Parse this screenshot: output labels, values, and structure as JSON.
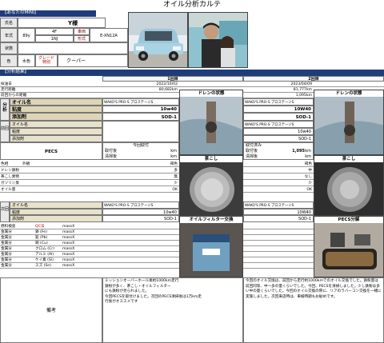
{
  "title": "オイル分析カルテ",
  "your_mini": {
    "section": "【あなたのMINI】",
    "name_label": "氏名",
    "name_value": "Y様",
    "model_year_label": "年式",
    "model_year_value": "89y",
    "spec1_top": "4F",
    "spec1_bottom": "1NJ",
    "spec2_top": "車両",
    "spec2_bottom": "形式",
    "engine_value": "E-XN12A",
    "condition_label": "状態",
    "color_label": "色",
    "color_value": "水色",
    "grade_label": "グレード",
    "grade_sub": "特別",
    "grade_value": "クーパー"
  },
  "results": {
    "section": "【分析結果】",
    "round1_header": "1回目",
    "round2_header": "2回目",
    "rows": [
      {
        "label": "採油日",
        "v1": "2022/10/02",
        "v2": "2023/04/09"
      },
      {
        "label": "走行距離",
        "v1": "80,682km",
        "v2": "81,777km"
      },
      {
        "label": "前回からの距離",
        "v1": "",
        "v2": "1,095km"
      }
    ],
    "analysis_group": "分析",
    "oil_name_label": "オイル名",
    "viscosity_label": "粘度",
    "additive_label": "添加剤",
    "r1_oil_name": "WAKO'S PRO-S プロステージS",
    "r1_viscosity": "10w40",
    "r1_additive": "SOD-1",
    "r2_oil_name": "WAKO'S PRO-S プロステージS",
    "r2_viscosity": "10W40",
    "r2_additive": "SOD-1",
    "prev_group": "前回",
    "r2_prev_oil_name": "WAKO'S PRO-S プロステージS",
    "r2_prev_viscosity": "10w40",
    "r2_prev_additive": "SOD-1",
    "pecs_label": "PECS",
    "r1_pecs_top": "今回取付",
    "r1_pecs_mid": "取付後",
    "r1_pecs_bot": "清掃後",
    "r2_pecs_top": "取付済み",
    "r2_pecs_mid": "取付後",
    "r2_pecs_mid_val": "1,095",
    "r2_pecs_bot": "清掃後",
    "km": "km",
    "checks": [
      {
        "label": "色相",
        "sub": "外観",
        "v1": "褐色",
        "v2": "褐色"
      },
      {
        "label": "ドレン鉄粉",
        "sub": "",
        "v1": "多",
        "v2": "中"
      },
      {
        "label": "茶こし異物",
        "sub": "",
        "v1": "無",
        "v2": "なし"
      },
      {
        "label": "ガソリン臭",
        "sub": "",
        "v1": "少",
        "v2": "少"
      },
      {
        "label": "オイル量",
        "sub": "",
        "v1": "OK",
        "v2": "OK"
      }
    ],
    "next_group": "次回",
    "r1_next_oil_name": "WAKO'S PRO-S プロステージS",
    "r1_next_viscosity": "10w40",
    "r1_next_additive": "SOD-1",
    "r2_next_oil_name": "WAKO'S PRO-S プロステージS",
    "r2_next_viscosity": "10W40",
    "r2_next_additive": "SOD-1",
    "metals_header": "燃料検査",
    "metals_col": "QC法",
    "metals": [
      {
        "label": "金属分",
        "el": "鉄 (Fe)",
        "unit": "massX"
      },
      {
        "label": "金属分",
        "el": "鉛 (Pb)",
        "unit": "massX"
      },
      {
        "label": "金属分",
        "el": "銅 (Cu)",
        "unit": "massX"
      },
      {
        "label": "金属分",
        "el": "クロム (Cr)",
        "unit": "massX"
      },
      {
        "label": "金属分",
        "el": "アルミ (Al)",
        "unit": "massX"
      },
      {
        "label": "金属分",
        "el": "ケイ素 (Si)",
        "unit": "massX"
      },
      {
        "label": "金属分",
        "el": "スズ (Sn)",
        "unit": "massX"
      }
    ],
    "remarks_label": "備考",
    "remarks1": "ミッションオーバーホール後約1000km走行\n鉄粉が多く、茶こし・オイルフィルター\nにも鉄粉が見られました。\n今回PECSを取付けました。次回のPECS清掃後は1万km走\n行後がオススメです",
    "remarks2": "今回のオイル交換は、前回から走行約1000kmでのオイル交換でした。鉄粉量は前回同等、中～多の量くらいでした。今回、PECSを清掃しました。少し鉄粉は多い中の量くらいでした。今回のオイル交換の際に、リアのラバーコン交換を一緒に実施しました。次回来店時は、車検時期もお勧めです。"
  },
  "photo_captions": {
    "drain1": "ドレンの状態",
    "drain2": "ドレンの状態",
    "strainer1": "茶こし",
    "strainer2": "茶こし",
    "filter": "オイルフィルター交換",
    "pecs": "PECS分解"
  }
}
